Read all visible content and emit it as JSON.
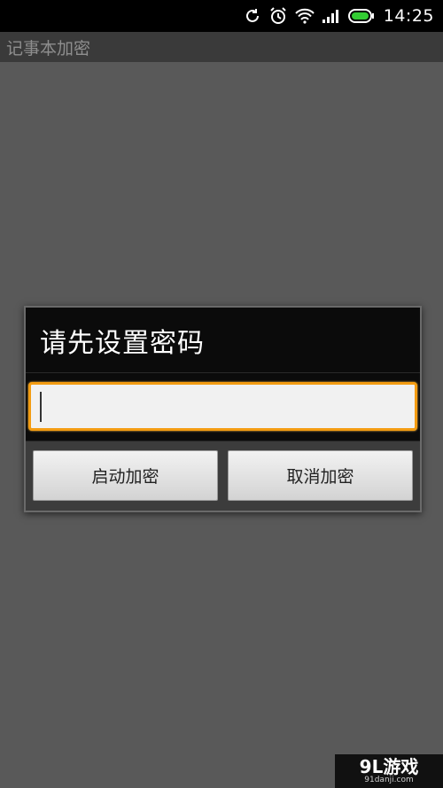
{
  "status_bar": {
    "time": "14:25",
    "icons": [
      "sync-icon",
      "alarm-icon",
      "wifi-icon",
      "signal-icon",
      "battery-icon"
    ]
  },
  "action_bar": {
    "title": "记事本加密"
  },
  "dialog": {
    "title": "请先设置密码",
    "password_value": "",
    "confirm_label": "启动加密",
    "cancel_label": "取消加密"
  },
  "watermark": {
    "logo": "9L游戏",
    "url": "91danji.com"
  },
  "colors": {
    "accent": "#f39c12",
    "battery": "#33cc33",
    "background": "#595959"
  }
}
